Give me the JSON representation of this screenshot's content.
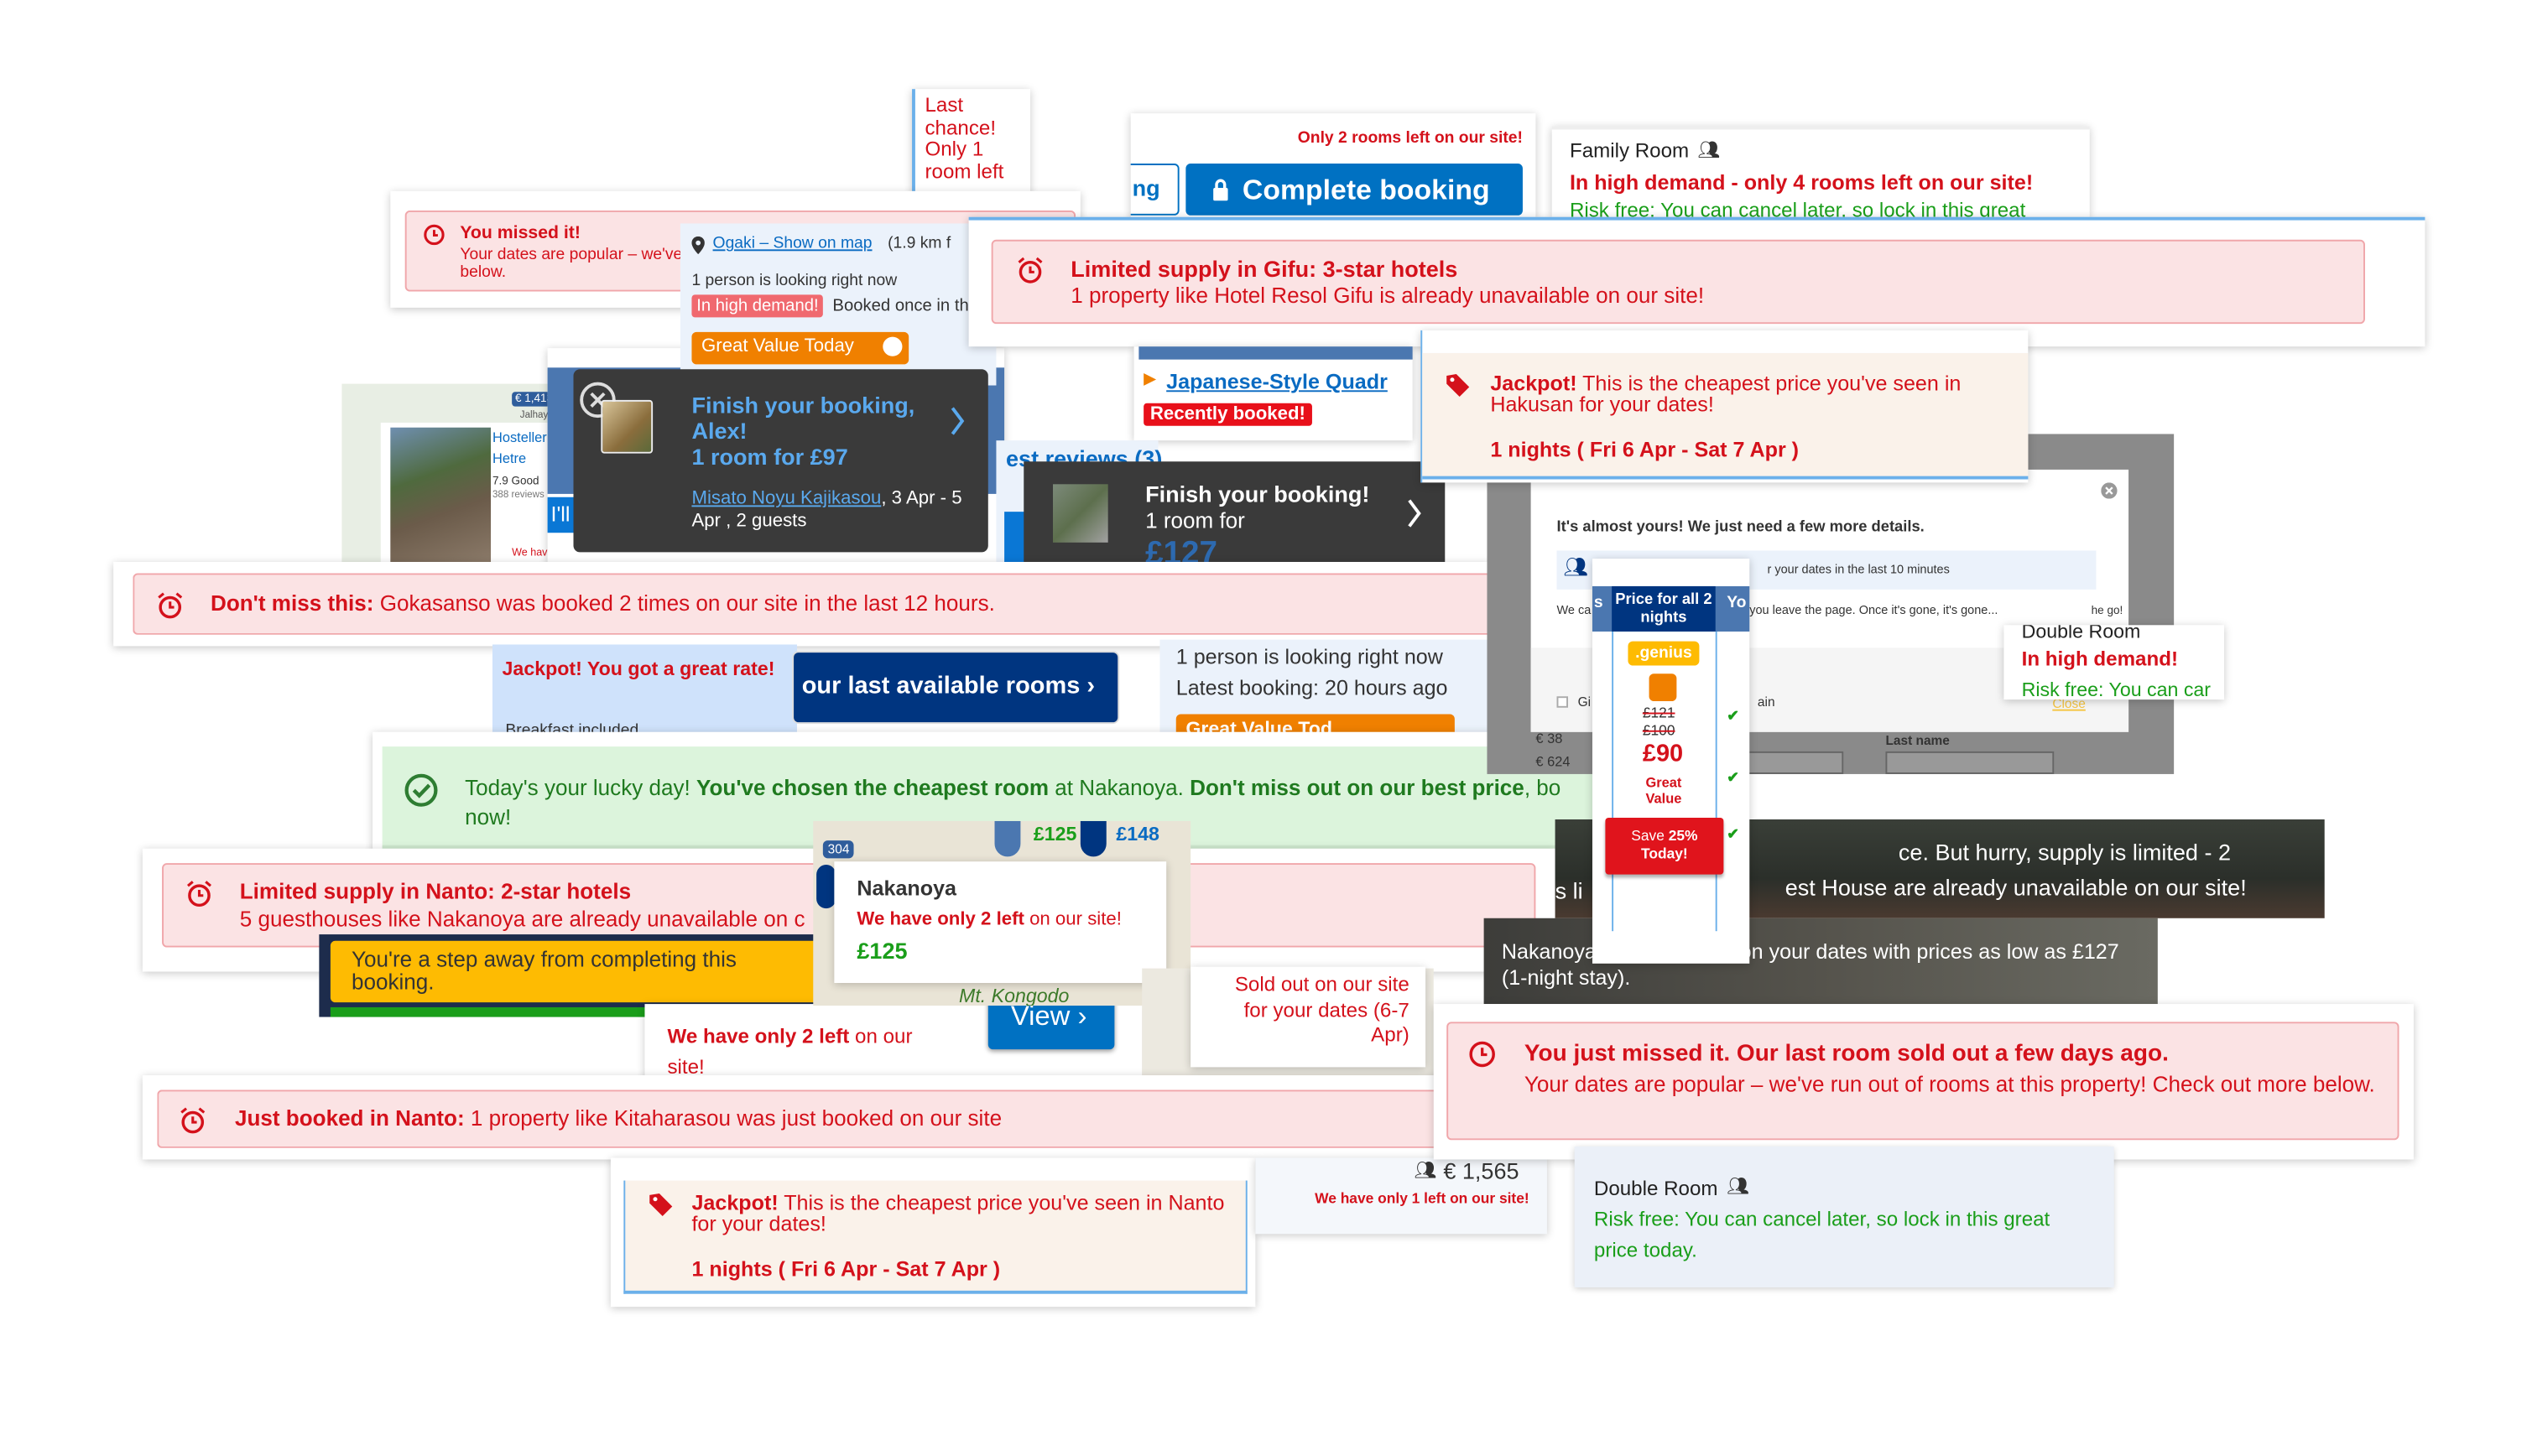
{
  "colors": {
    "alert_red": "#d4111b",
    "alert_bg": "#fbe3e4",
    "success_green": "#1a9e1a",
    "brand_blue": "#0071c2",
    "dark_navy": "#003580",
    "orange": "#f08000",
    "genius_yellow": "#febb02"
  },
  "last_chance": {
    "text": "Last chance! Only 1 room left"
  },
  "missed_small": {
    "title": "You missed it!",
    "body": "Your dates are popular – we've",
    "body2": "below."
  },
  "hotel_map": {
    "price_pin": "€ 1,413",
    "town": "Jalhay",
    "name": "Hosteller",
    "name2": "Hetre",
    "rating": "7.9 Good",
    "reviews": "388 reviews",
    "reserve": "I'll reserve",
    "we_have": "We hav"
  },
  "ogaki": {
    "location_link": "Ogaki – Show on map",
    "distance": "(1.9 km f",
    "looking": "1 person is looking right now",
    "demand_badge": "In high demand!",
    "booked": "Booked once in th",
    "great_value": "Great Value Today"
  },
  "finish_alex": {
    "title": "Finish your booking, Alex!",
    "price": "1 room for £97",
    "property_link": "Misato Noyu Kajikasou",
    "details": ", 3 Apr - 5 Apr , 2 guests"
  },
  "complete": {
    "only_rooms": "Only 2 rooms left on our site!",
    "prev_button": "ng",
    "button": "Complete booking"
  },
  "family": {
    "room": "Family Room",
    "demand": "In high demand - only 4 rooms left on our site!",
    "risk": "Risk free: You can cancel later, so lock in this great"
  },
  "gifu": {
    "title": "Limited supply in Gifu: 3-star hotels",
    "body": "1 property like Hotel Resol Gifu is already unavailable on our site!"
  },
  "japanese": {
    "link": "Japanese-Style Quadr",
    "badge": "Recently booked!"
  },
  "jackpot_hakusan": {
    "bold": "Jackpot!",
    "text": " This is the cheapest price you've seen in Hakusan for your dates!",
    "nights": "1 nights ( Fri 6 Apr - Sat 7 Apr )"
  },
  "finish2": {
    "reviews": "est reviews (3)",
    "title": "Finish your booking!",
    "price_label": "1 room for",
    "price": "£127"
  },
  "modal": {
    "title": "It's almost yours! We just need a few more details.",
    "viewers": "r your dates in the last 10 minutes",
    "warning": "We ca",
    "warning2": "you leave the page. Once it's gone, it's gone...",
    "go": "he go!",
    "close": "Close",
    "checkbox_label": "Gi",
    "last_name": "Last name",
    "price_a": "€ 38",
    "price_b": "€ 624"
  },
  "double_small": {
    "room": "Double Room",
    "demand": "In high demand!",
    "risk": "Risk free: You can car"
  },
  "dont_miss": {
    "bold": "Don't miss this:",
    "text": " Gokasanso was booked 2 times on our site in the last 12 hours."
  },
  "jackpot_rate": {
    "text": "Jackpot! You got a great rate!",
    "breakfast": "Breakfast included"
  },
  "last_rooms": {
    "button": "our last available rooms"
  },
  "looking": {
    "line1": "1 person is looking right now",
    "line2": "Latest booking: 20 hours ago",
    "badge": "Great Value Tod"
  },
  "lucky": {
    "t1": "Today's your lucky day! ",
    "b1": "You've chosen the cheapest room",
    "t2": " at Nakanoya. ",
    "b2": "Don't miss out on our best price",
    "t3": ", bo",
    "t4": "now!"
  },
  "nanto_supply": {
    "title": "Limited supply in Nanto: 2-star hotels",
    "body": "5 guesthouses like Nakanoya are already unavailable on c"
  },
  "step": {
    "text": "You're a step away from completing this booking."
  },
  "map": {
    "route": "304",
    "pin1": "£125",
    "pin2": "£148",
    "name": "Nakanoya",
    "only_bold": "We have only 2 left",
    "only_rest": " on our site!",
    "price": "£125",
    "mountain": "Mt. Kongodo"
  },
  "only2": {
    "bold": "We have only 2 left",
    "rest": " on our site!"
  },
  "view": {
    "button": "View"
  },
  "sold_out": {
    "text": "Sold out on our site for your dates (6-7 Apr)"
  },
  "just_booked": {
    "bold": "Just booked in Nanto:",
    "text": " 1 property like Kitaharasou was just booked on our site"
  },
  "jackpot_nanto": {
    "bold": "Jackpot!",
    "text": " This is the cheapest price you've seen in Nanto for your dates!",
    "nights": "1 nights ( Fri 6 Apr - Sat 7 Apr )"
  },
  "price_1565": {
    "price": "€ 1,565",
    "only": "We have only 1 left on our site!"
  },
  "banner1": {
    "line1": "ce. But hurry, supply is limited - 2",
    "line2": "est House are already unavailable on our site!",
    "s": "s li"
  },
  "banner2": {
    "line1a": "Nakanoya",
    "line1b": "on your dates with prices as low as £127",
    "line2": "(1-night stay)."
  },
  "price_col": {
    "left_head": "s",
    "header": "Price for all 2 nights",
    "right_head": "Yo",
    "genius": ".genius",
    "old1": "£121",
    "old2": "£100",
    "price": "£90",
    "label": "Great Value",
    "save_a": "Save ",
    "save_b": "25%",
    "save_c": "Today!"
  },
  "missed_big": {
    "title": "You just missed it. Our last room sold out a few days ago.",
    "body": "Your dates are popular – we've run out of rooms at this property! Check out more below."
  },
  "double_big": {
    "room": "Double Room",
    "risk": "Risk free: You can cancel later, so lock in this great price today."
  }
}
